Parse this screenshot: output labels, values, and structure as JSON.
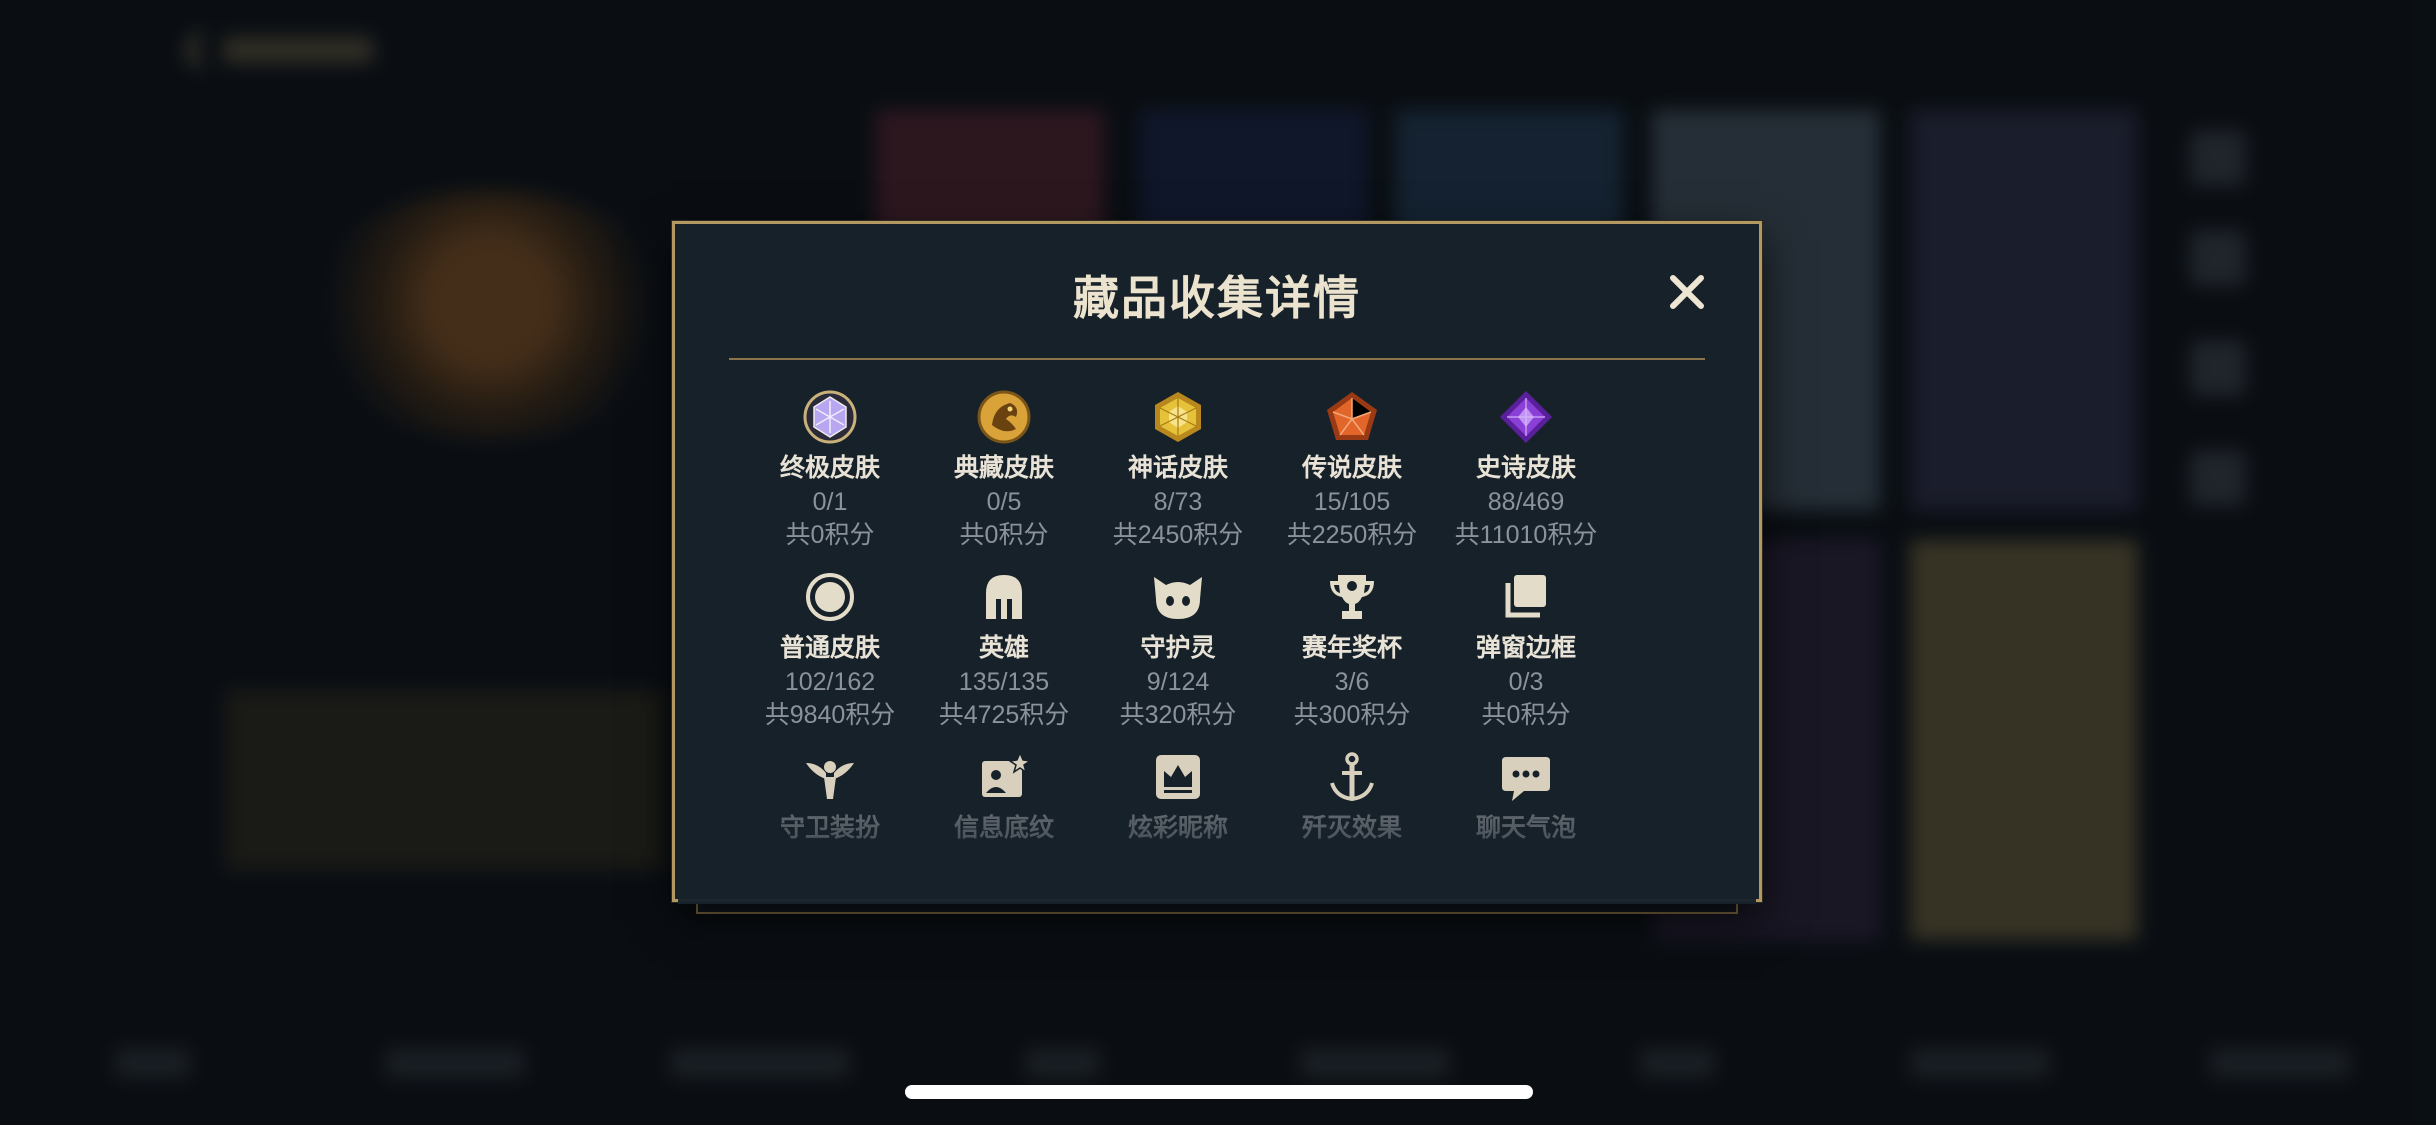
{
  "dialog": {
    "title": "藏品收集详情",
    "close_glyph": "✕",
    "categories": [
      {
        "name": "终极皮肤",
        "count": "0/1",
        "score": "共0积分",
        "icon": "ultimate-skin-gem-icon",
        "color": "#b8a6f0"
      },
      {
        "name": "典藏皮肤",
        "count": "0/5",
        "score": "共0积分",
        "icon": "prestige-skin-dragon-icon",
        "color": "#d9a33a"
      },
      {
        "name": "神话皮肤",
        "count": "8/73",
        "score": "共2450积分",
        "icon": "mythic-skin-gem-icon",
        "color": "#e6c23a"
      },
      {
        "name": "传说皮肤",
        "count": "15/105",
        "score": "共2250积分",
        "icon": "legendary-skin-gem-icon",
        "color": "#e2662a"
      },
      {
        "name": "史诗皮肤",
        "count": "88/469",
        "score": "共11010积分",
        "icon": "epic-skin-gem-icon",
        "color": "#8a3fd6"
      },
      {
        "name": "普通皮肤",
        "count": "102/162",
        "score": "共9840积分",
        "icon": "standard-skin-icon",
        "color": "#e3dcc8"
      },
      {
        "name": "英雄",
        "count": "135/135",
        "score": "共4725积分",
        "icon": "champion-helmet-icon",
        "color": "#e3dcc8"
      },
      {
        "name": "守护灵",
        "count": "9/124",
        "score": "共320积分",
        "icon": "companion-icon",
        "color": "#e3dcc8"
      },
      {
        "name": "赛年奖杯",
        "count": "3/6",
        "score": "共300积分",
        "icon": "trophy-icon",
        "color": "#e3dcc8"
      },
      {
        "name": "弹窗边框",
        "count": "0/3",
        "score": "共0积分",
        "icon": "popup-frame-icon",
        "color": "#e3dcc8"
      },
      {
        "name": "守卫装扮",
        "icon": "ward-skin-icon",
        "color": "#d8d0bd"
      },
      {
        "name": "信息底纹",
        "icon": "banner-icon",
        "color": "#d8d0bd"
      },
      {
        "name": "炫彩昵称",
        "icon": "colored-name-icon",
        "color": "#d8d0bd"
      },
      {
        "name": "歼灭效果",
        "icon": "finisher-effect-icon",
        "color": "#d8d0bd"
      },
      {
        "name": "聊天气泡",
        "icon": "chat-bubble-icon",
        "color": "#d8d0bd"
      }
    ]
  },
  "accent_gold": "#b49862"
}
